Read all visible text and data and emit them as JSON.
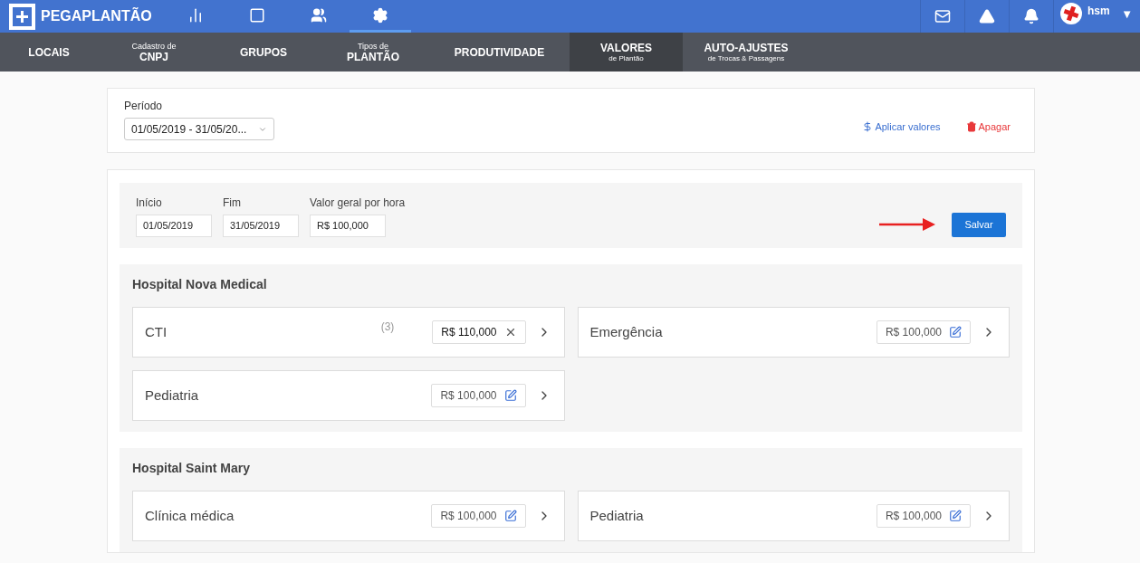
{
  "brand": "PEGAPLANTÃO",
  "top_icons": [
    {
      "kind": "chart",
      "selected": false
    },
    {
      "kind": "calendar",
      "selected": false
    },
    {
      "kind": "people",
      "selected": false
    },
    {
      "kind": "gear",
      "selected": true
    }
  ],
  "right_icons": [
    {
      "kind": "mail"
    },
    {
      "kind": "alert"
    },
    {
      "kind": "bell"
    }
  ],
  "user": {
    "name": "hsm",
    "caret": "▼"
  },
  "subnav": [
    {
      "main": "LOCAIS",
      "selected": false
    },
    {
      "top": "Cadastro de",
      "main": "CNPJ",
      "selected": false
    },
    {
      "main": "GRUPOS",
      "selected": false
    },
    {
      "top": "Tipos de",
      "main": "PLANTÃO",
      "selected": false
    },
    {
      "main": "PRODUTIVIDADE",
      "selected": false
    },
    {
      "main": "VALORES",
      "bottom": "de Plantão",
      "selected": true
    },
    {
      "main": "AUTO-AJUSTES",
      "bottom": "de Trocas & Passagens",
      "selected": false
    }
  ],
  "period": {
    "label": "Período",
    "value": "01/05/2019 - 31/05/20...",
    "apply": "Aplicar valores",
    "delete": "Apagar"
  },
  "form": {
    "fields": [
      {
        "label": "Início",
        "value": "01/05/2019"
      },
      {
        "label": "Fim",
        "value": "31/05/2019"
      },
      {
        "label": "Valor geral por hora",
        "value": "R$ 100,000"
      }
    ],
    "save": "Salvar"
  },
  "hospitals": [
    {
      "name": "Hospital Nova Medical",
      "units": [
        {
          "name": "CTI",
          "count": "(3)",
          "value": "R$ 110,000",
          "kind": "editing"
        },
        {
          "name": "Emergência",
          "value": "R$ 100,000",
          "kind": "saved"
        },
        {
          "name": "Pediatria",
          "value": "R$ 100,000",
          "kind": "saved"
        }
      ]
    },
    {
      "name": "Hospital Saint Mary",
      "units": [
        {
          "name": "Clínica médica",
          "value": "R$ 100,000",
          "kind": "saved"
        },
        {
          "name": "Pediatria",
          "value": "R$ 100,000",
          "kind": "saved"
        }
      ]
    }
  ]
}
